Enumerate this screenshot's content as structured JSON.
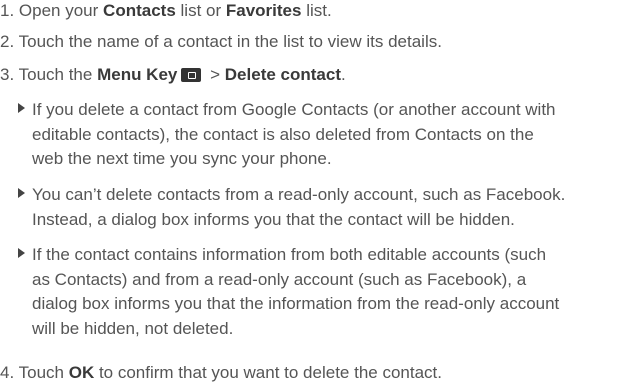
{
  "steps": [
    {
      "num": "1.",
      "pre": "Open your",
      "b1": "Contacts",
      "mid": "list or",
      "b2": "Favorites",
      "post": "list."
    },
    {
      "num": "2.",
      "text": "Touch the name of a contact in the list to view its details."
    },
    {
      "num": "3.",
      "pre": "Touch the",
      "b1": "Menu Key",
      "icon": "menu-key-icon",
      "sep": ">",
      "b2": "Delete contact",
      "post": "."
    },
    {
      "num": "4.",
      "pre": "Touch",
      "b1": "OK",
      "post": "to confirm that you want to delete the contact."
    }
  ],
  "bullets": [
    {
      "text": "If you delete a contact from Google Contacts (or another account with\neditable contacts), the contact is also deleted from Contacts on the\nweb the next time you sync your phone."
    },
    {
      "text": "You can’t delete contacts from a read-only account, such as Facebook.\nInstead, a dialog box informs you that the contact will be hidden."
    },
    {
      "text": "If the contact contains information from both editable accounts (such\nas Contacts) and from a read-only account (such as Facebook), a\ndialog box informs you that the information from the read-only account\nwill be hidden, not deleted."
    }
  ]
}
